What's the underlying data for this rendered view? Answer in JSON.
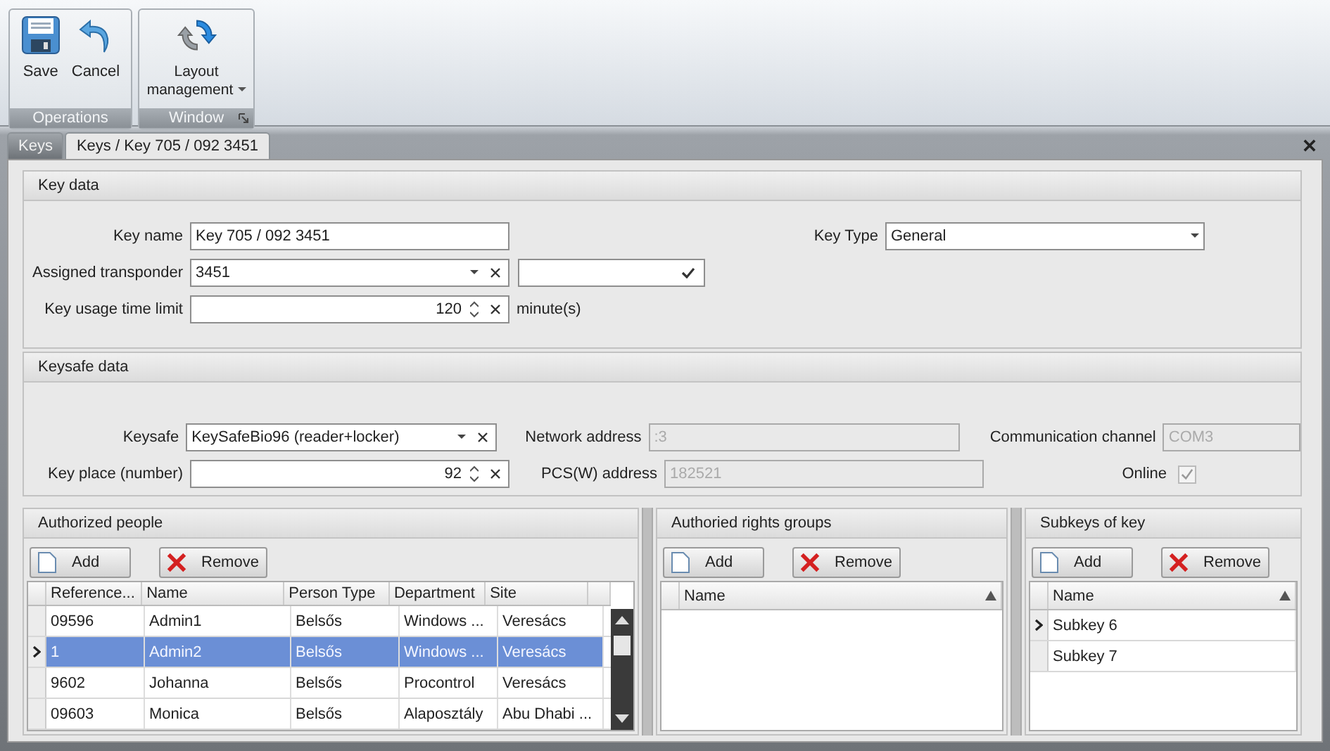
{
  "ribbon": {
    "groups": [
      {
        "label": "Operations",
        "launcher": false,
        "buttons": [
          {
            "label": "Save",
            "kind": "save",
            "dropdown": false
          },
          {
            "label": "Cancel",
            "kind": "undo",
            "dropdown": false
          }
        ]
      },
      {
        "label": "Window",
        "launcher": true,
        "buttons": [
          {
            "label": "Layout management",
            "kind": "refresh",
            "dropdown": true
          }
        ]
      }
    ]
  },
  "tabs": [
    {
      "label": "Keys",
      "selected": false
    },
    {
      "label": "Keys / Key 705 / 092 3451",
      "selected": true
    }
  ],
  "key_data": {
    "title": "Key data",
    "key_name": {
      "label": "Key name",
      "value": "Key 705 / 092 3451"
    },
    "key_type": {
      "label": "Key Type",
      "value": "General"
    },
    "assigned_transponder": {
      "label": "Assigned transponder",
      "value": "3451"
    },
    "time_limit": {
      "label": "Key usage time limit",
      "value": "120",
      "unit": "minute(s)"
    }
  },
  "keysafe_data": {
    "title": "Keysafe data",
    "keysafe": {
      "label": "Keysafe",
      "value": "KeySafeBio96 (reader+locker)"
    },
    "key_place": {
      "label": "Key place (number)",
      "value": "92"
    },
    "network_address": {
      "label": "Network address",
      "value": ":3",
      "disabled": true
    },
    "pcs_address": {
      "label": "PCS(W) address",
      "value": "182521",
      "disabled": true
    },
    "communication_channel": {
      "label": "Communication channel",
      "value": "COM3",
      "disabled": true
    },
    "online": {
      "label": "Online",
      "checked": true,
      "disabled": true
    }
  },
  "authorized_people": {
    "title": "Authorized people",
    "add": "Add",
    "remove": "Remove",
    "columns": [
      "Reference...",
      "Name",
      "Person Type",
      "Department",
      "Site"
    ],
    "rows": [
      {
        "selected": false,
        "current": false,
        "cells": [
          "09596",
          "Admin1",
          "Belsős",
          "Windows ...",
          "Veresács"
        ]
      },
      {
        "selected": true,
        "current": true,
        "cells": [
          "1",
          "Admin2",
          "Belsős",
          "Windows ...",
          "Veresács"
        ]
      },
      {
        "selected": false,
        "current": false,
        "cells": [
          "9602",
          "Johanna",
          "Belsős",
          "Procontrol",
          "Veresács"
        ]
      },
      {
        "selected": false,
        "current": false,
        "cells": [
          "09603",
          "Monica",
          "Belsős",
          "Alaposztály",
          "Abu Dhabi ..."
        ]
      }
    ]
  },
  "rights_groups": {
    "title": "Authoried rights groups",
    "add": "Add",
    "remove": "Remove",
    "columns": [
      "Name"
    ]
  },
  "subkeys": {
    "title": "Subkeys of key",
    "add": "Add",
    "remove": "Remove",
    "columns": [
      "Name"
    ],
    "rows": [
      {
        "selected": false,
        "current": true,
        "cells": [
          "Subkey 6"
        ]
      },
      {
        "selected": false,
        "current": false,
        "cells": [
          "Subkey 7"
        ]
      }
    ]
  }
}
